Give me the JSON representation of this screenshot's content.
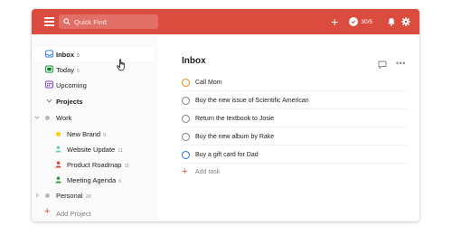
{
  "header": {
    "search_placeholder": "Quick Find",
    "karma_text": "30/5",
    "colors": {
      "bar": "#db4c3f"
    }
  },
  "sidebar": {
    "nav": [
      {
        "label": "Inbox",
        "count": "5",
        "icon": "inbox-icon",
        "color": "#246fe0"
      },
      {
        "label": "Today",
        "count": "5",
        "icon": "today-icon",
        "color": "#058527"
      },
      {
        "label": "Upcoming",
        "count": "",
        "icon": "upcoming-icon",
        "color": "#692fc2"
      }
    ],
    "projects_label": "Projects",
    "work": {
      "label": "Work"
    },
    "sub_projects": [
      {
        "label": "New Brand",
        "count": "9",
        "color": "#fad000",
        "icon": "dot"
      },
      {
        "label": "Website Update",
        "count": "11",
        "color": "#6accbc",
        "icon": "person"
      },
      {
        "label": "Product Roadmap",
        "count": "11",
        "color": "#db4035",
        "icon": "person"
      },
      {
        "label": "Meeting Agenda",
        "count": "6",
        "color": "#299438",
        "icon": "person"
      }
    ],
    "personal": {
      "label": "Personal",
      "count": "28"
    },
    "add_project_label": "Add Project"
  },
  "main": {
    "title": "Inbox",
    "more_label": "•••",
    "tasks": [
      {
        "label": "Call Mom",
        "color": "#eb8909"
      },
      {
        "label": "Buy the new issue of Scientific American",
        "color": "#808080"
      },
      {
        "label": "Return the textbook to Josie",
        "color": "#808080"
      },
      {
        "label": "Buy the new album by Rake",
        "color": "#808080"
      },
      {
        "label": "Buy a gift card for Dad",
        "color": "#246fe0"
      }
    ],
    "add_task_label": "Add task"
  }
}
